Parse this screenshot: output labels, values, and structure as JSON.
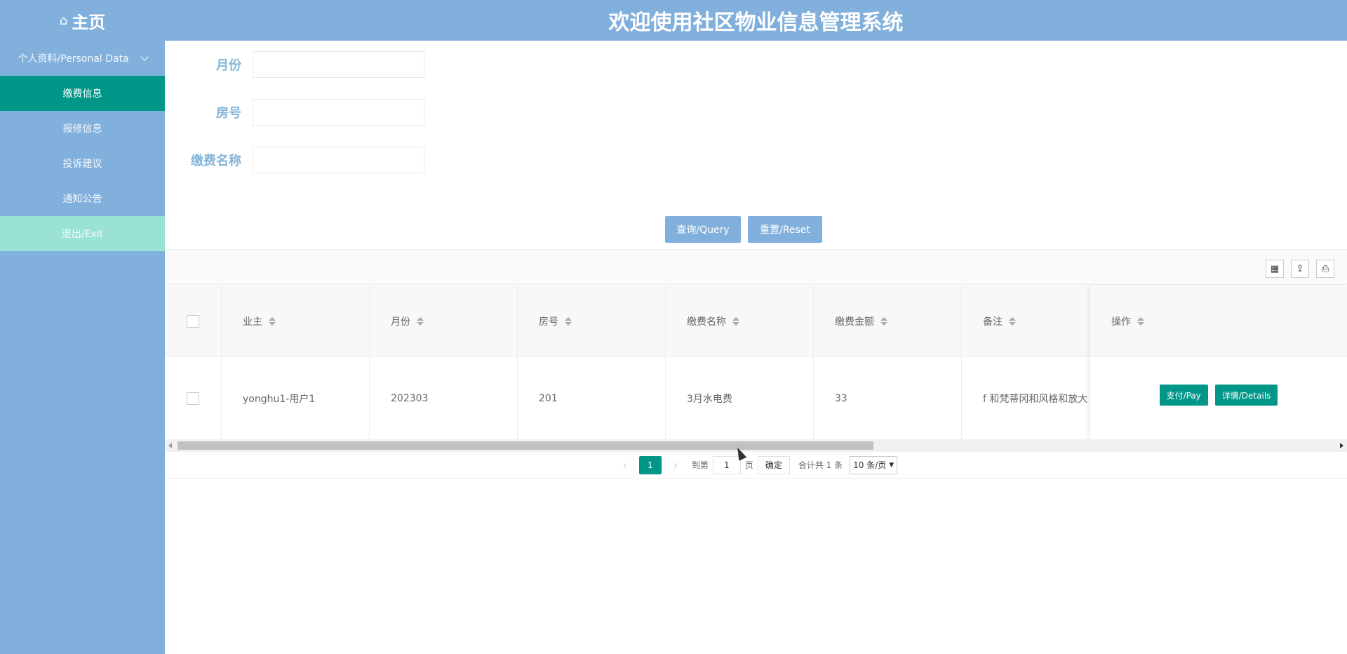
{
  "header": {
    "home_label": "主页",
    "home_icon": "home-icon",
    "system_title": "欢迎使用社区物业信息管理系统"
  },
  "sidebar": {
    "group_label": "个人资料/Personal Data",
    "items": [
      {
        "label": "缴费信息",
        "active": true
      },
      {
        "label": "报修信息"
      },
      {
        "label": "投诉建议"
      },
      {
        "label": "通知公告"
      },
      {
        "label": "退出/Exit"
      }
    ]
  },
  "search": {
    "month_label": "月份",
    "month_value": "",
    "room_label": "房号",
    "room_value": "",
    "fee_name_label": "缴费名称",
    "fee_name_value": "",
    "query_label": "查询/Query",
    "reset_label": "重置/Reset"
  },
  "toolbar": {
    "icons": [
      "columns-icon",
      "export-icon",
      "print-icon"
    ]
  },
  "table": {
    "columns": [
      "业主",
      "月份",
      "房号",
      "缴费名称",
      "缴费金额",
      "备注",
      "操作"
    ],
    "rows": [
      {
        "owner": "yonghu1-用户1",
        "month": "202303",
        "room": "201",
        "fee_name": "3月水电费",
        "amount": "33",
        "remark": "f 和梵蒂冈和风格和放大",
        "pay_label": "支付/Pay",
        "details_label": "详情/Details"
      }
    ]
  },
  "pager": {
    "current_page": "1",
    "goto_prefix": "到第",
    "goto_value": "1",
    "goto_suffix": "页",
    "confirm_label": "确定",
    "total_text": "合计共 1 条",
    "page_size": "10 条/页"
  },
  "colors": {
    "primary": "#82b0dc",
    "accent": "#009688",
    "exit_bg": "#99e2d4"
  }
}
